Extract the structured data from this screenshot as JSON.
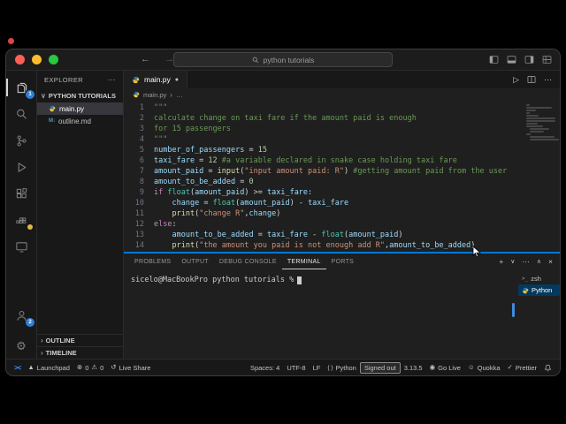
{
  "colors": {
    "accent_blue": "#0078d4",
    "badge_blue": "#2f7fd6",
    "warning_yellow": "#e2b73d",
    "traffic_red": "#ff5f57",
    "traffic_yellow": "#febc2e",
    "traffic_green": "#28c840"
  },
  "titlebar": {
    "window_title": "python tutorials"
  },
  "activity_bar": {
    "explorer_badge": "1",
    "accounts_badge": "2"
  },
  "sidebar": {
    "header": "EXPLORER",
    "section_title": "PYTHON TUTORIALS",
    "files": [
      {
        "name": "main.py",
        "icon": "python",
        "selected": true
      },
      {
        "name": "outline.md",
        "icon": "markdown",
        "selected": false
      }
    ],
    "bottom_sections": [
      {
        "label": "OUTLINE"
      },
      {
        "label": "TIMELINE"
      }
    ]
  },
  "editor": {
    "tab_label": "main.py",
    "modified_indicator": "●",
    "breadcrumb_file": "main.py",
    "breadcrumb_more": "…",
    "code_lines": [
      [
        {
          "t": "\"\"\"",
          "c": "doc"
        }
      ],
      [
        {
          "t": "calculate change on taxi fare if the amount paid is enough",
          "c": "doc"
        }
      ],
      [
        {
          "t": "for 15 passengers",
          "c": "doc"
        }
      ],
      [
        {
          "t": "\"\"\"",
          "c": "doc"
        }
      ],
      [
        {
          "t": "number_of_passengers",
          "c": "v"
        },
        {
          "t": " = ",
          "c": "p"
        },
        {
          "t": "15",
          "c": "n"
        }
      ],
      [
        {
          "t": "taxi_fare",
          "c": "v"
        },
        {
          "t": " = ",
          "c": "p"
        },
        {
          "t": "12",
          "c": "n"
        },
        {
          "t": " #a variable declared in snake case holding taxi fare",
          "c": "com"
        }
      ],
      [
        {
          "t": "amount_paid",
          "c": "v"
        },
        {
          "t": " = ",
          "c": "p"
        },
        {
          "t": "input",
          "c": "fn"
        },
        {
          "t": "(",
          "c": "p"
        },
        {
          "t": "\"input amount paid: R\"",
          "c": "str"
        },
        {
          "t": ")",
          "c": "p"
        },
        {
          "t": " #getting amount paid from the user",
          "c": "com"
        }
      ],
      [
        {
          "t": "amount_to_be_added",
          "c": "v"
        },
        {
          "t": " = ",
          "c": "p"
        },
        {
          "t": "0",
          "c": "n"
        }
      ],
      [
        {
          "t": "if",
          "c": "kw"
        },
        {
          "t": " ",
          "c": "p"
        },
        {
          "t": "float",
          "c": "cls"
        },
        {
          "t": "(",
          "c": "p"
        },
        {
          "t": "amount_paid",
          "c": "v"
        },
        {
          "t": ") >= ",
          "c": "p"
        },
        {
          "t": "taxi_fare",
          "c": "v"
        },
        {
          "t": ":",
          "c": "p"
        }
      ],
      [
        {
          "t": "    ",
          "c": "p"
        },
        {
          "t": "change",
          "c": "v"
        },
        {
          "t": " = ",
          "c": "p"
        },
        {
          "t": "float",
          "c": "cls"
        },
        {
          "t": "(",
          "c": "p"
        },
        {
          "t": "amount_paid",
          "c": "v"
        },
        {
          "t": ") - ",
          "c": "p"
        },
        {
          "t": "taxi_fare",
          "c": "v"
        }
      ],
      [
        {
          "t": "    ",
          "c": "p"
        },
        {
          "t": "print",
          "c": "fn"
        },
        {
          "t": "(",
          "c": "p"
        },
        {
          "t": "\"change R\"",
          "c": "str"
        },
        {
          "t": ",",
          "c": "p"
        },
        {
          "t": "change",
          "c": "v"
        },
        {
          "t": ")",
          "c": "p"
        }
      ],
      [
        {
          "t": "else",
          "c": "kw"
        },
        {
          "t": ":",
          "c": "p"
        }
      ],
      [
        {
          "t": "    ",
          "c": "p"
        },
        {
          "t": "amount_to_be_added",
          "c": "v"
        },
        {
          "t": " = ",
          "c": "p"
        },
        {
          "t": "taxi_fare",
          "c": "v"
        },
        {
          "t": " - ",
          "c": "p"
        },
        {
          "t": "float",
          "c": "cls"
        },
        {
          "t": "(",
          "c": "p"
        },
        {
          "t": "amount_paid",
          "c": "v"
        },
        {
          "t": ")",
          "c": "p"
        }
      ],
      [
        {
          "t": "    ",
          "c": "p"
        },
        {
          "t": "print",
          "c": "fn"
        },
        {
          "t": "(",
          "c": "p"
        },
        {
          "t": "\"the amount you paid is not enough add R\"",
          "c": "str"
        },
        {
          "t": ",",
          "c": "p"
        },
        {
          "t": "amount_to_be_added",
          "c": "v"
        },
        {
          "t": ")",
          "c": "p"
        }
      ]
    ]
  },
  "panel": {
    "tabs": [
      "PROBLEMS",
      "OUTPUT",
      "DEBUG CONSOLE",
      "TERMINAL",
      "PORTS"
    ],
    "active_tab": "TERMINAL",
    "terminal_prompt": "sicelo@MacBookPro python tutorials %",
    "terminal_list": [
      {
        "label": "zsh",
        "icon": "terminal",
        "selected": false
      },
      {
        "label": "Python",
        "icon": "python",
        "selected": true
      }
    ]
  },
  "status_bar": {
    "launchpad": "Launchpad",
    "errors": "0",
    "warnings": "0",
    "live_share": "Live Share",
    "spaces": "Spaces: 4",
    "encoding": "UTF-8",
    "eol": "LF",
    "language": "Python",
    "signed_out": "Signed out",
    "interpreter_version": "3.13.5",
    "go_live": "Go Live",
    "quokka": "Quokka",
    "prettier": "Prettier"
  }
}
